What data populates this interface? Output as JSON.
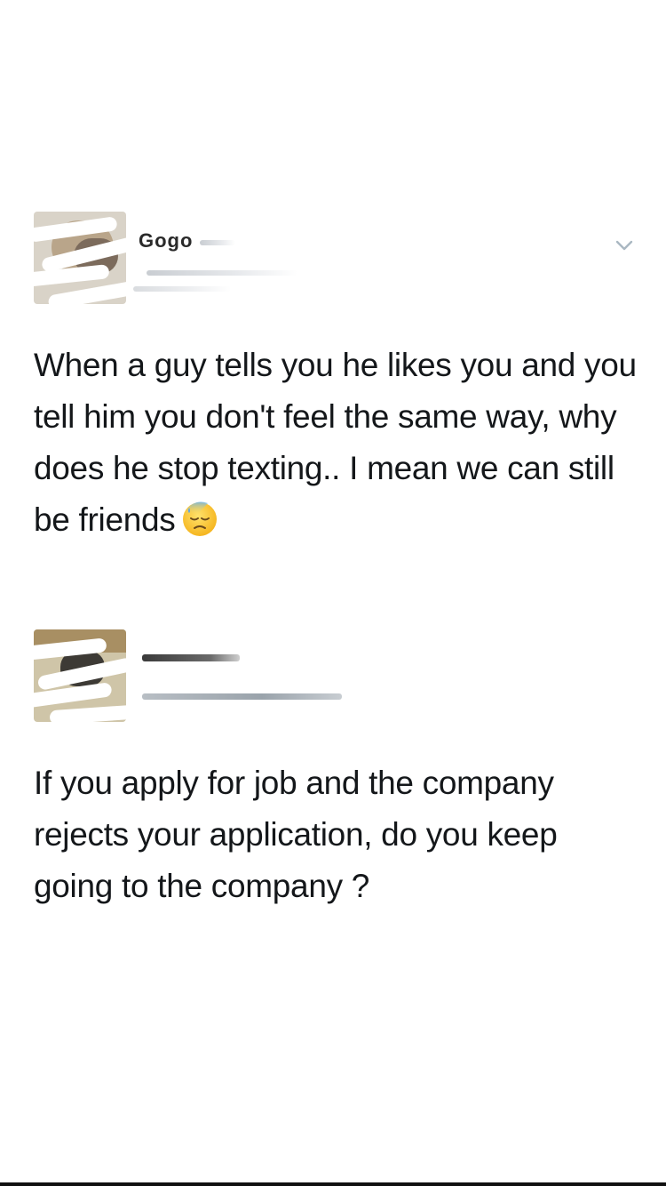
{
  "tweets": [
    {
      "display_name": "Gogo",
      "handle": "",
      "text_before_emoji": "When a guy tells you he likes you and you tell him you don't feel the same way, why does he stop texting.. I mean we can still be friends",
      "emoji": "downcast-face-with-sweat"
    },
    {
      "display_name": "",
      "handle": "",
      "text_before_emoji": "If you apply for job and the company rejects your application, do you keep going to the company ?"
    }
  ],
  "colors": {
    "text": "#14171a",
    "secondary": "#9aa3ab",
    "background": "#ffffff"
  },
  "icons": {
    "menu": "chevron-down-icon"
  }
}
